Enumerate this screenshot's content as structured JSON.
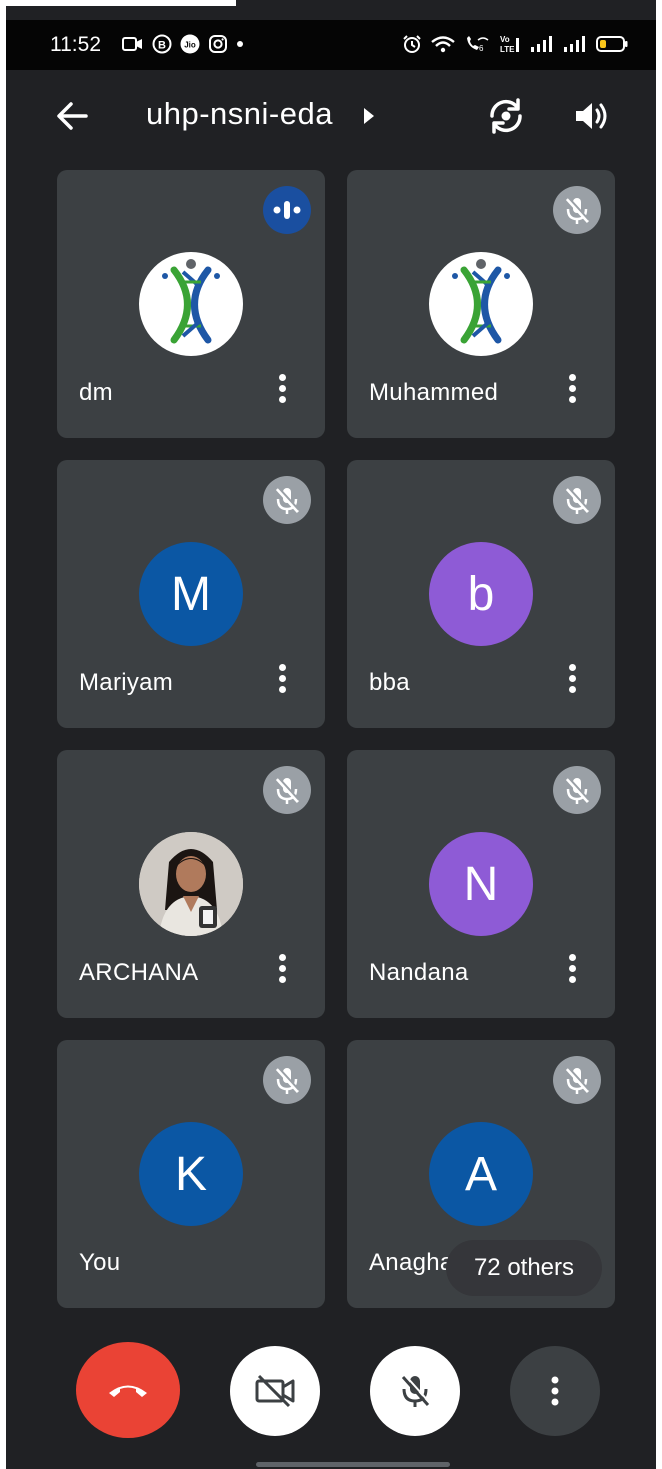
{
  "status_bar": {
    "time": "11:52",
    "left_icons": [
      "video-icon",
      "b-badge-icon",
      "jio-icon",
      "instagram-icon",
      "dot-icon"
    ],
    "right_icons": [
      "alarm-icon",
      "wifi-icon",
      "wifi-calling-icon",
      "volte-icon",
      "signal-icon",
      "signal-icon",
      "battery-icon"
    ]
  },
  "header": {
    "title": "uhp-nsni-eda"
  },
  "participants": [
    {
      "name": "dm",
      "avatar": "logo",
      "speaking": true
    },
    {
      "name": "Muhammed",
      "avatar": "logo",
      "speaking": false
    },
    {
      "name": "Mariyam",
      "avatar": "letter",
      "initial": "M",
      "color": "#0b57a4",
      "speaking": false
    },
    {
      "name": "bba",
      "avatar": "letter",
      "initial": "b",
      "color": "#8e5bd6",
      "speaking": false
    },
    {
      "name": "ARCHANA",
      "avatar": "photo",
      "speaking": false
    },
    {
      "name": "Nandana",
      "avatar": "letter",
      "initial": "N",
      "color": "#8e5bd6",
      "speaking": false
    },
    {
      "name": "You",
      "avatar": "letter",
      "initial": "K",
      "color": "#0b57a4",
      "speaking": false
    },
    {
      "name": "Anagha",
      "avatar": "letter",
      "initial": "A",
      "color": "#0b57a4",
      "speaking": false
    }
  ],
  "others_chip": "72 others",
  "controls": {
    "end_call_color": "#ea4335",
    "icons": [
      "end-call-icon",
      "camera-off-icon",
      "mic-off-icon",
      "more-vert-icon"
    ]
  }
}
